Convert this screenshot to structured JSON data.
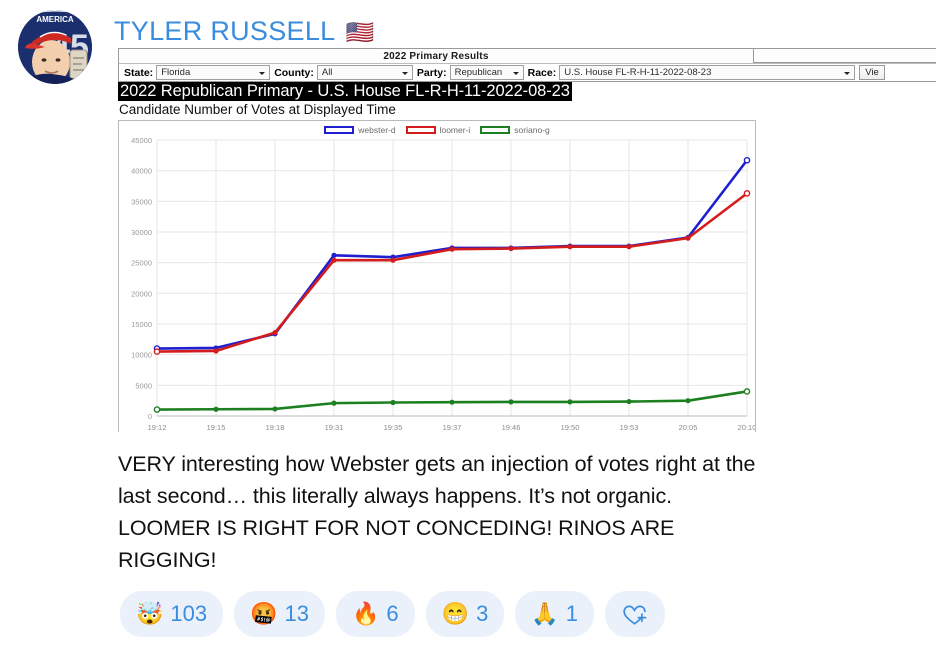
{
  "post": {
    "author_name": "TYLER RUSSELL",
    "author_flag": "🇺🇸",
    "body_text": "VERY interesting how Webster gets an injection of votes right at the last second… this literally always happens. It’s not organic. LOOMER IS RIGHT FOR NOT CONCEDING! RINOS ARE RIGGING!"
  },
  "embed": {
    "app_title": "2022 Primary Results",
    "controls": {
      "state_label": "State:",
      "state_value": "Florida",
      "county_label": "County:",
      "county_value": "All",
      "party_label": "Party:",
      "party_value": "Republican",
      "race_label": "Race:",
      "race_value": "U.S. House FL-R-H-11-2022-08-23",
      "view_button": "Vie"
    },
    "race_banner": "2022 Republican Primary - U.S. House FL-R-H-11-2022-08-23",
    "chart_caption": "Candidate Number of Votes at Displayed Time"
  },
  "chart_data": {
    "type": "line",
    "title": "Candidate Number of Votes at Displayed Time",
    "xlabel": "",
    "ylabel": "",
    "grid": true,
    "legend_position": "top-center",
    "ylim": [
      0,
      45000
    ],
    "yticks": [
      0,
      5000,
      10000,
      15000,
      20000,
      25000,
      30000,
      35000,
      40000,
      45000
    ],
    "categories": [
      "19:12",
      "19:15",
      "19:18",
      "19:31",
      "19:35",
      "19:37",
      "19:46",
      "19:50",
      "19:53",
      "20:05",
      "20:10"
    ],
    "series": [
      {
        "name": "webster-d",
        "color": "#1f1fcf",
        "values": [
          11000,
          11100,
          13400,
          26200,
          25900,
          27400,
          27400,
          27700,
          27700,
          29100,
          41700
        ]
      },
      {
        "name": "loomer-i",
        "color": "#d41c1c",
        "values": [
          10500,
          10600,
          13600,
          25400,
          25400,
          27200,
          27300,
          27600,
          27600,
          29000,
          36300
        ]
      },
      {
        "name": "soriano-g",
        "color": "#1d8020",
        "values": [
          1050,
          1100,
          1150,
          2100,
          2200,
          2250,
          2300,
          2300,
          2350,
          2500,
          4000
        ]
      }
    ]
  },
  "reactions": [
    {
      "emoji": "🤯",
      "count": "103",
      "name": "mind-blown"
    },
    {
      "emoji": "🤬",
      "count": "13",
      "name": "angry-cursing"
    },
    {
      "emoji": "🔥",
      "count": "6",
      "name": "fire"
    },
    {
      "emoji": "😁",
      "count": "3",
      "name": "grin"
    },
    {
      "emoji": "🙏",
      "count": "1",
      "name": "pray"
    }
  ],
  "add_reaction_label": "add-reaction"
}
